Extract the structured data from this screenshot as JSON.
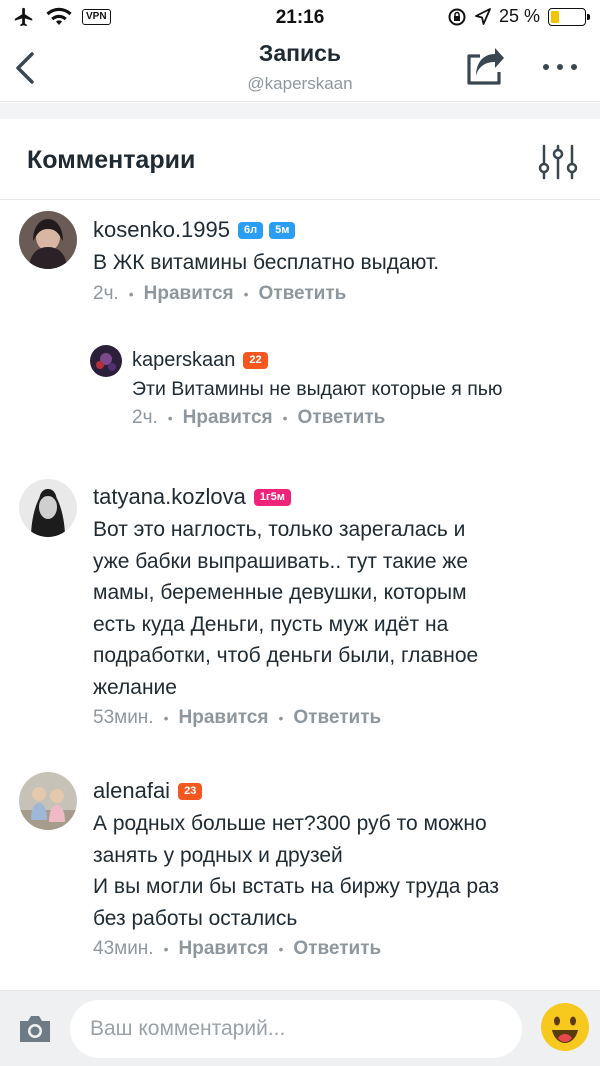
{
  "status_bar": {
    "time": "21:16",
    "vpn_label": "VPN",
    "battery": "25 %",
    "battery_level": 0.25
  },
  "nav": {
    "title": "Запись",
    "subtitle": "@kaperskaan"
  },
  "section": {
    "title": "Комментарии"
  },
  "comments": [
    {
      "username": "kosenko.1995",
      "badges": [
        "6л",
        "5м"
      ],
      "text": "В ЖК витамины бесплатно выдают.",
      "time": "2ч.",
      "like": "Нравится",
      "reply": "Ответить",
      "reply_comment": {
        "username": "kaperskaan",
        "badge": "22",
        "text": "Эти Витамины не выдают которые я пью",
        "time": "2ч.",
        "like": "Нравится",
        "reply": "Ответить"
      }
    },
    {
      "username": "tatyana.kozlova",
      "badges": [
        "1г5м"
      ],
      "lines": [
        "Вот это наглость, только зарегалась и",
        "уже бабки выпрашивать.. тут такие же",
        "мамы, беременные девушки, которым",
        "есть куда Деньги, пусть муж идёт на",
        "подработки, чтоб деньги были, главное",
        "желание"
      ],
      "time": "53мин.",
      "like": "Нравится",
      "reply": "Ответить"
    },
    {
      "username": "alenafai",
      "badges": [
        "23"
      ],
      "lines": [
        "А родных больше нет?300 руб то можно",
        "занять у родных и друзей",
        "И вы могли бы встать на биржу труда раз",
        "без работы остались"
      ],
      "time": "43мин.",
      "like": "Нравится",
      "reply": "Ответить"
    }
  ],
  "composer": {
    "placeholder": "Ваш комментарий..."
  },
  "colors": {
    "accent_blue": "#2a9df4",
    "badge_orange": "#f4571f",
    "badge_pink": "#f0237a",
    "text_primary": "#1f2a33",
    "text_secondary": "#8e979e",
    "emoji_yellow": "#f7c81e"
  },
  "icons": [
    "airplane-icon",
    "wifi-icon",
    "lock-rotation-icon",
    "location-arrow-icon",
    "back-chevron-icon",
    "share-icon",
    "more-icon",
    "filter-icon",
    "camera-icon",
    "emoji-icon"
  ]
}
